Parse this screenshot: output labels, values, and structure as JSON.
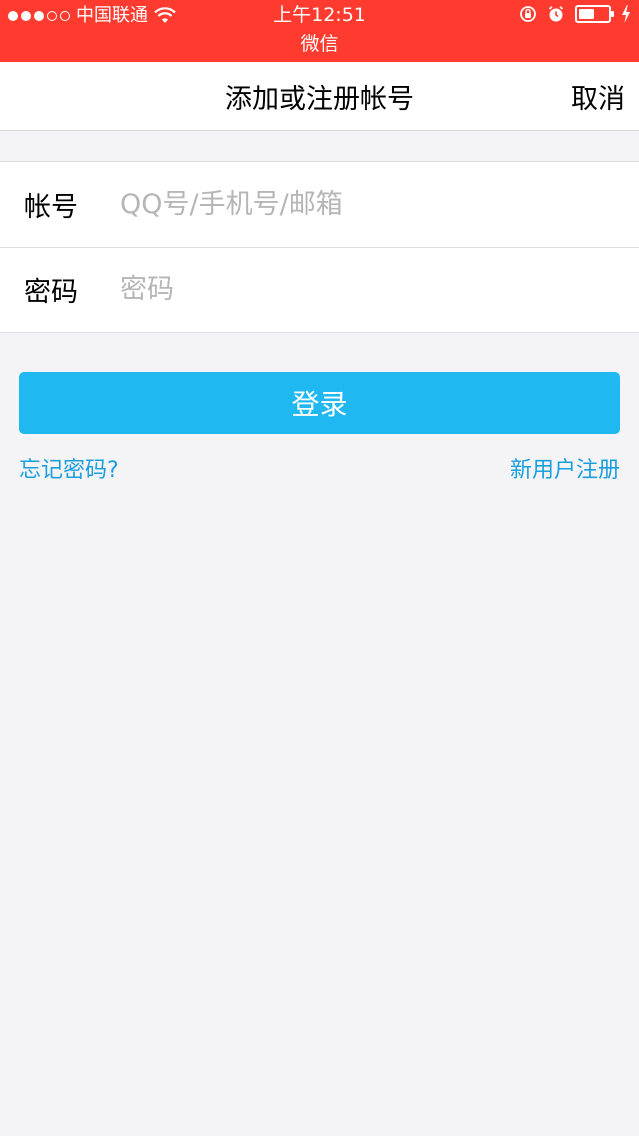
{
  "status_bar": {
    "carrier": "中国联通",
    "time": "上午12:51",
    "app": "微信",
    "battery_level": 0.55
  },
  "nav": {
    "title": "添加或注册帐号",
    "cancel": "取消"
  },
  "form": {
    "account_label": "帐号",
    "account_placeholder": "QQ号/手机号/邮箱",
    "password_label": "密码",
    "password_placeholder": "密码"
  },
  "actions": {
    "login": "登录",
    "forgot_password": "忘记密码?",
    "register": "新用户注册"
  },
  "colors": {
    "status_bar": "#ff3b30",
    "primary": "#1fb8f0",
    "link": "#1a9fde"
  }
}
